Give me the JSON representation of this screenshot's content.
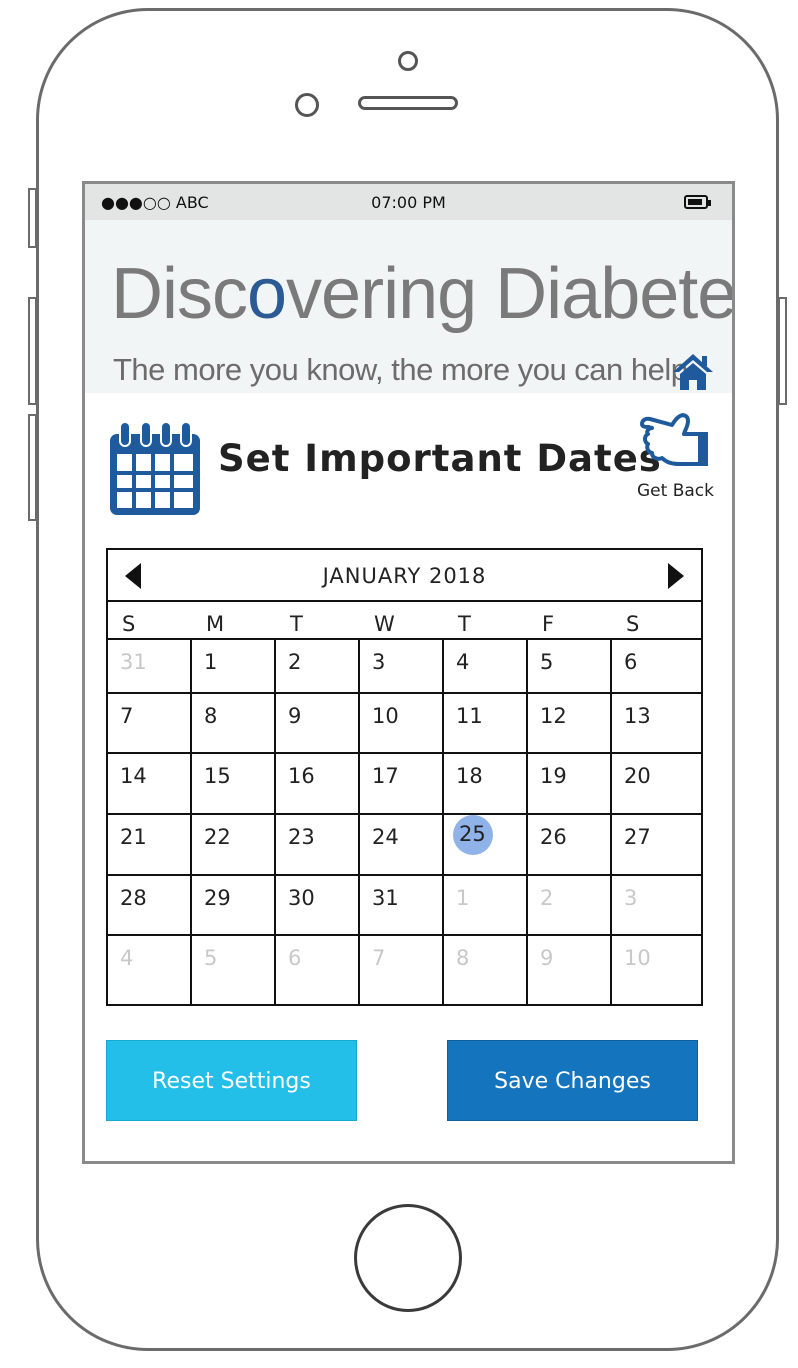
{
  "status_bar": {
    "carrier": "●●●○○ ABC",
    "time": "07:00 PM"
  },
  "banner": {
    "brand_before": "Disc",
    "brand_accent": "o",
    "brand_after": "vering Diabetes",
    "tagline": "The more you know, the more you can help.",
    "home_icon": "home-icon"
  },
  "header": {
    "title": "Set Important Dates",
    "back_label": "Get Back",
    "calendar_icon": "calendar-icon",
    "back_icon": "pointing-hand-icon"
  },
  "calendar": {
    "month_label": "JANUARY 2018",
    "weekdays": [
      "S",
      "M",
      "T",
      "W",
      "T",
      "F",
      "S"
    ],
    "weeks": [
      [
        "31",
        "1",
        "2",
        "3",
        "4",
        "5",
        "6"
      ],
      [
        "7",
        "8",
        "9",
        "10",
        "11",
        "12",
        "13"
      ],
      [
        "14",
        "15",
        "16",
        "17",
        "18",
        "19",
        "20"
      ],
      [
        "21",
        "22",
        "23",
        "24",
        "25",
        "26",
        "27"
      ],
      [
        "28",
        "29",
        "30",
        "31",
        "1",
        "2",
        "3"
      ],
      [
        "4",
        "5",
        "6",
        "7",
        "8",
        "9",
        "10"
      ]
    ],
    "selected_day": "25"
  },
  "buttons": {
    "reset": "Reset Settings",
    "save": "Save Changes"
  },
  "colors": {
    "accent_blue": "#1474bd",
    "light_blue": "#24bfe8",
    "selected_day": "#8fb3e8",
    "icon_blue": "#1f5b9c"
  }
}
